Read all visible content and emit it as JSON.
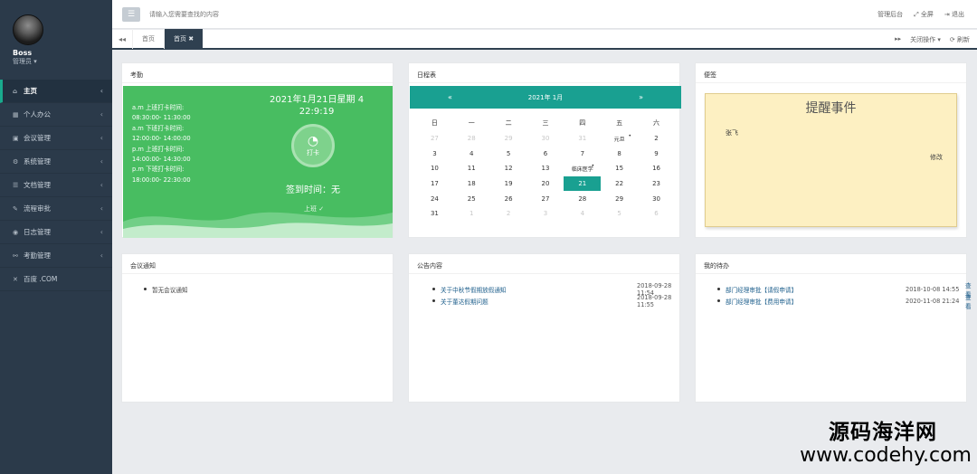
{
  "profile": {
    "name": "Boss",
    "role": "管理员 ▾"
  },
  "sidebar": {
    "items": [
      {
        "label": "主页",
        "icon": "home-icon",
        "glyph": "⌂"
      },
      {
        "label": "个人办公",
        "icon": "calendar-icon",
        "glyph": "▦"
      },
      {
        "label": "会议管理",
        "icon": "meeting-icon",
        "glyph": "▣"
      },
      {
        "label": "系统管理",
        "icon": "gear-icon",
        "glyph": "⚙"
      },
      {
        "label": "文档管理",
        "icon": "document-icon",
        "glyph": "☰"
      },
      {
        "label": "流程审批",
        "icon": "wrench-icon",
        "glyph": "✎"
      },
      {
        "label": "日志管理",
        "icon": "eye-icon",
        "glyph": "◉"
      },
      {
        "label": "考勤管理",
        "icon": "link-icon",
        "glyph": "⚯"
      },
      {
        "label": "百度 .COM",
        "icon": "close-icon",
        "glyph": "✕"
      }
    ]
  },
  "topbar": {
    "search_placeholder": "请输入您需要查找的内容",
    "menu_glyph": "☰",
    "right": [
      "管理后台",
      "⤢ 全屏",
      "⇥ 退出"
    ]
  },
  "tabs": {
    "left_arrow": "◂◂",
    "items": [
      "首页",
      "首页 ✖"
    ],
    "right_arrow": "▸▸",
    "actions": [
      "关闭操作 ▾",
      "⟳ 刷新"
    ]
  },
  "attendance": {
    "title": "考勤",
    "schedule": [
      "a.m 上班打卡时间:",
      "08:30:00- 11:30:00",
      "a.m 下班打卡时间:",
      "12:00:00- 14:00:00",
      "p.m 上班打卡时间:",
      "14:00:00- 14:30:00",
      "p.m 下班打卡时间:",
      "18:00:00- 22:30:00"
    ],
    "date": "2021年1月21日星期 4",
    "time": "22:9:19",
    "clock_label": "打卡",
    "signin": "签到时间：无",
    "faint": "上班 ✓"
  },
  "calendar": {
    "title": "日程表",
    "prev": "«",
    "next": "»",
    "month_label": "2021年  1月",
    "weekdays": [
      "日",
      "一",
      "二",
      "三",
      "四",
      "五",
      "六"
    ],
    "weeks": [
      [
        {
          "t": "27",
          "m": 1
        },
        {
          "t": "28",
          "m": 1
        },
        {
          "t": "29",
          "m": 1
        },
        {
          "t": "30",
          "m": 1
        },
        {
          "t": "31",
          "m": 1
        },
        {
          "t": "元旦",
          "h": 1,
          "dot": 1
        },
        {
          "t": "2"
        }
      ],
      [
        {
          "t": "3"
        },
        {
          "t": "4"
        },
        {
          "t": "5"
        },
        {
          "t": "6"
        },
        {
          "t": "7"
        },
        {
          "t": "8"
        },
        {
          "t": "9"
        }
      ],
      [
        {
          "t": "10"
        },
        {
          "t": "11"
        },
        {
          "t": "12"
        },
        {
          "t": "13"
        },
        {
          "t": "临床医学",
          "h": 1,
          "dot": 1
        },
        {
          "t": "15"
        },
        {
          "t": "16"
        }
      ],
      [
        {
          "t": "17"
        },
        {
          "t": "18"
        },
        {
          "t": "19"
        },
        {
          "t": "20"
        },
        {
          "t": "21",
          "s": 1
        },
        {
          "t": "22"
        },
        {
          "t": "23"
        }
      ],
      [
        {
          "t": "24"
        },
        {
          "t": "25"
        },
        {
          "t": "26"
        },
        {
          "t": "27"
        },
        {
          "t": "28"
        },
        {
          "t": "29"
        },
        {
          "t": "30"
        }
      ],
      [
        {
          "t": "31"
        },
        {
          "t": "1",
          "m": 1
        },
        {
          "t": "2",
          "m": 1
        },
        {
          "t": "3",
          "m": 1
        },
        {
          "t": "4",
          "m": 1
        },
        {
          "t": "5",
          "m": 1
        },
        {
          "t": "6",
          "m": 1
        }
      ]
    ]
  },
  "notes": {
    "title": "便签",
    "heading": "提醒事件",
    "body": "张飞",
    "edit": "修改"
  },
  "meetings": {
    "title": "会议通知",
    "items": [
      "暂无会议通知"
    ]
  },
  "announcements": {
    "title": "公告内容",
    "items": [
      {
        "text": "关于中秋节假期放假通知",
        "time": "2018-09-28 11:54"
      },
      {
        "text": "关于董达假期问题",
        "time": "2018-09-28 11:55"
      }
    ]
  },
  "todos": {
    "title": "我的待办",
    "items": [
      {
        "text": "部门经理审批【请假申请】",
        "time": "2018-10-08 14:55",
        "action": "查看"
      },
      {
        "text": "部门经理审批【费用申请】",
        "time": "2020-11-08 21:24",
        "action": "查看"
      }
    ]
  },
  "watermark": {
    "line1": "源码海洋网",
    "line2": "www.codehy.com"
  }
}
